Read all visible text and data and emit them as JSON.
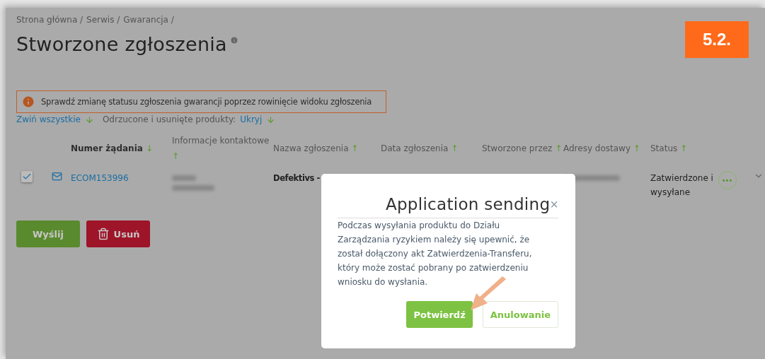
{
  "breadcrumb": [
    "Strona główna /",
    "Serwis /",
    "Gwarancja /"
  ],
  "title": "Stworzone zgłoszenia",
  "step_badge": "5.2.",
  "alert": "Sprawdź zmianę statusu zgłoszenia gwarancji poprzez rowinięcie widoku zgłoszenia",
  "view_links": {
    "collapse": "Zwiń wszystkie",
    "filter_label": "Odrzucone i usunięte produkty:",
    "filter_value": "Ukryj"
  },
  "table": {
    "columns": [
      {
        "label": "Numer żądania",
        "sort": "↓",
        "bold": true
      },
      {
        "label": "Informacje kontaktowe",
        "sort": "↑",
        "bold": false
      },
      {
        "label": "Nazwa zgłoszenia",
        "sort": "↑",
        "bold": false
      },
      {
        "label": "Data zgłoszenia",
        "sort": "↑",
        "bold": false
      },
      {
        "label": "Stworzone przez",
        "sort": "↑",
        "bold": false
      },
      {
        "label": "Adresy dostawy",
        "sort": "↑",
        "bold": false
      },
      {
        "label": "Status",
        "sort": "↑",
        "bold": false
      }
    ],
    "rows": [
      {
        "checked": true,
        "number": "ECOM153996",
        "name": "Defektivs -",
        "status": "Zatwierdzone i wysyłane",
        "more": "•••"
      }
    ]
  },
  "actions": [
    {
      "label": "Wyślij",
      "kind": "send"
    },
    {
      "label": "Usuń",
      "kind": "delete"
    }
  ],
  "dialog": {
    "title": "Application sending",
    "close": "×",
    "body": "Podczas wysyłania produktu do Działu Zarządzania ryzykiem należy się upewnić, że został dołączony akt Zatwierdzenia-Transferu, który może zostać pobrany po zatwierdzeniu wniosku do wysłania.",
    "buttons": [
      {
        "label": "Potwierdź",
        "kind": "primary"
      },
      {
        "label": "Anulowanie",
        "kind": "secondary"
      }
    ]
  }
}
